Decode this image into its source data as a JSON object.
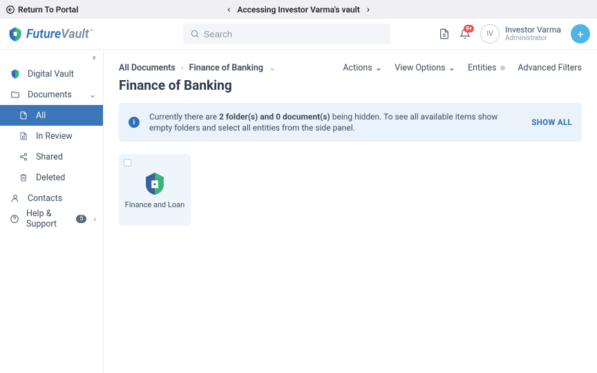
{
  "topstrip": {
    "return_label": "Return To Portal",
    "center_label": "Accessing Investor Varma's vault"
  },
  "brand": {
    "future": "Future",
    "vault": "Vault",
    "tm": "™"
  },
  "search": {
    "placeholder": "Search"
  },
  "notifications": {
    "count": "9+"
  },
  "user": {
    "initials": "IV",
    "name": "Investor Varma",
    "role": "Administrator"
  },
  "sidebar": {
    "digital_vault": "Digital Vault",
    "documents": "Documents",
    "all": "All",
    "in_review": "In Review",
    "shared": "Shared",
    "deleted": "Deleted",
    "contacts": "Contacts",
    "help": "Help & Support",
    "help_badge": "5"
  },
  "crumbs": {
    "root": "All Documents",
    "current": "Finance of Banking"
  },
  "page_title": "Finance of Banking",
  "toolbar": {
    "actions": "Actions",
    "view_options": "View Options",
    "entities": "Entities",
    "advanced_filters": "Advanced Filters"
  },
  "banner": {
    "pre": "Currently there are ",
    "bold": "2 folder(s) and 0 document(s)",
    "post": " being hidden. To see all available items show empty folders and select all entities from the side panel.",
    "show_all": "SHOW ALL"
  },
  "folders": [
    {
      "label": "Finance and Loan"
    }
  ]
}
